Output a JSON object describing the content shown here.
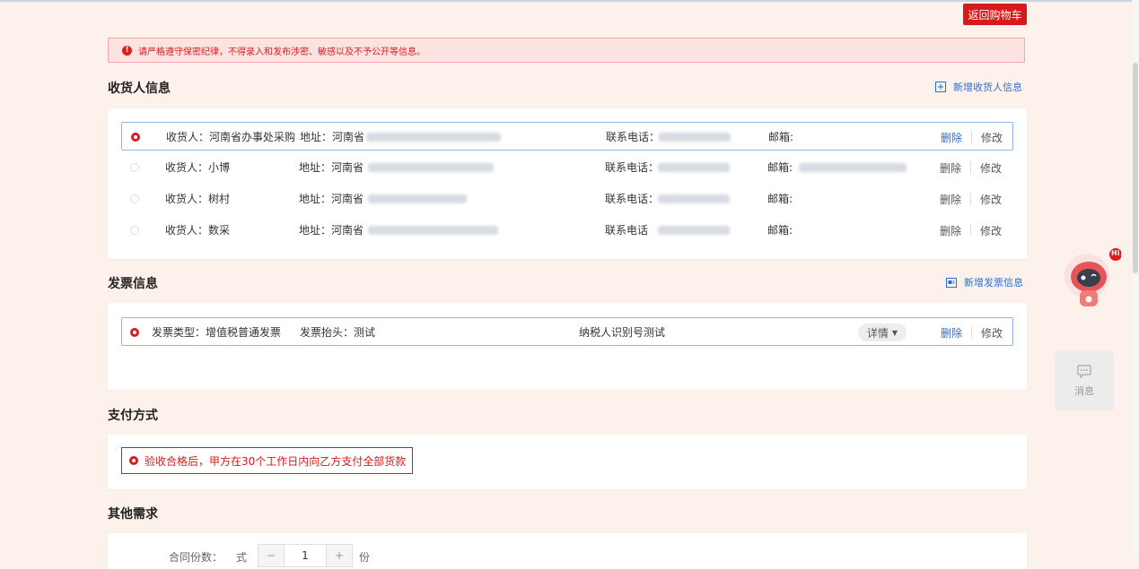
{
  "header": {
    "back_to_cart": "返回购物车"
  },
  "notice": {
    "text": "请严格遵守保密纪律，不得录入和发布涉密、敏感以及不予公开等信息。"
  },
  "recipient": {
    "title": "收货人信息",
    "add_label": "新增收货人信息",
    "items": [
      {
        "name": "收货人：河南省办事处采购",
        "address": "地址：河南省",
        "phone": "联系电话：",
        "email": "邮箱:",
        "selected": true
      },
      {
        "name": "收货人：小博",
        "address": "地址：河南省",
        "phone": "联系电话：",
        "email": "邮箱:",
        "selected": false
      },
      {
        "name": "收货人：树村",
        "address": "地址：河南省",
        "phone": "联系电话：",
        "email": "邮箱:",
        "selected": false
      },
      {
        "name": "收货人：数采",
        "address": "地址：河南省",
        "phone": "联系电话",
        "email": "邮箱:",
        "selected": false
      }
    ],
    "delete_label": "删除",
    "edit_label": "修改"
  },
  "invoice": {
    "title": "发票信息",
    "add_label": "新增发票信息",
    "item": {
      "type": "发票类型：增值税普通发票",
      "header": "发票抬头：测试",
      "taxpayer": "纳税人识别号测试",
      "detail_label": "详情",
      "selected": true
    },
    "delete_label": "删除",
    "edit_label": "修改"
  },
  "payment": {
    "title": "支付方式",
    "option": "验收合格后，甲方在30个工作日内向乙方支付全部货款"
  },
  "other": {
    "title": "其他需求",
    "contract_label": "合同份数：",
    "unit_prefix": "式",
    "quantity": "1",
    "unit_suffix": "份",
    "minus": "−",
    "plus": "+"
  },
  "side": {
    "message_label": "消息",
    "robot_badge": "Hi"
  },
  "colors": {
    "accent_red": "#d61b1b",
    "link_blue": "#2a6fd1"
  }
}
